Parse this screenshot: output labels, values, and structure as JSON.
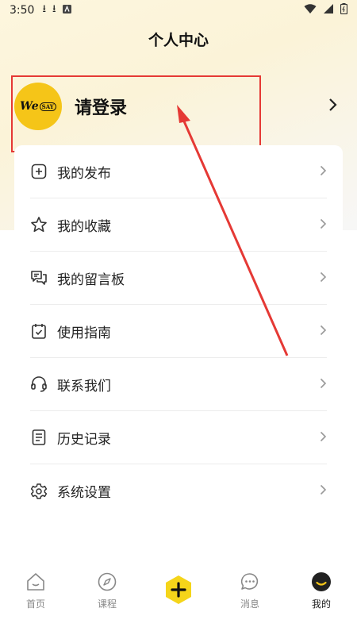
{
  "status_bar": {
    "time": "3:50"
  },
  "page": {
    "title": "个人中心"
  },
  "profile": {
    "avatar_text": "We",
    "avatar_badge": "SAY",
    "login_label": "请登录"
  },
  "menu": [
    {
      "label": "我的发布",
      "icon": "plus-square-icon"
    },
    {
      "label": "我的收藏",
      "icon": "star-icon"
    },
    {
      "label": "我的留言板",
      "icon": "message-board-icon"
    },
    {
      "label": "使用指南",
      "icon": "calendar-check-icon"
    },
    {
      "label": "联系我们",
      "icon": "headset-icon"
    },
    {
      "label": "历史记录",
      "icon": "document-icon"
    },
    {
      "label": "系统设置",
      "icon": "gear-icon"
    }
  ],
  "tabbar": {
    "tabs": [
      {
        "label": "首页",
        "icon": "home-icon"
      },
      {
        "label": "课程",
        "icon": "compass-icon"
      },
      {
        "label": "",
        "icon": "add-icon"
      },
      {
        "label": "消息",
        "icon": "chat-icon"
      },
      {
        "label": "我的",
        "icon": "profile-icon",
        "active": true
      }
    ]
  },
  "colors": {
    "accent": "#f5c518",
    "highlight": "#e53935",
    "text": "#222222"
  }
}
